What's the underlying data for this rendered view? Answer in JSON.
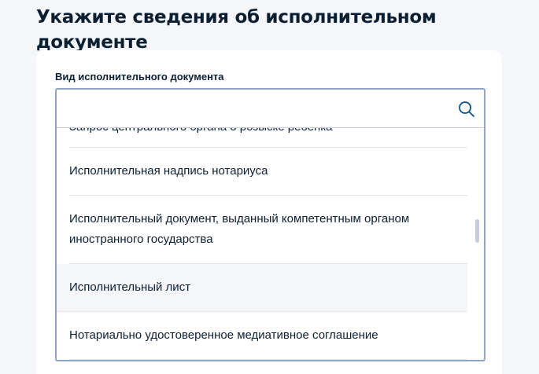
{
  "page": {
    "title": "Укажите сведения об исполнительном документе"
  },
  "form": {
    "field_label": "Вид исполнительного документа",
    "search": {
      "value": "",
      "placeholder": "",
      "icon": "search-icon"
    },
    "options": [
      "Запрос центрального органа о розыске ребенка",
      "Исполнительная надпись нотариуса",
      "Исполнительный документ, выданный компетентным органом иностранного государства",
      "Исполнительный лист",
      "Нотариально удостоверенное медиативное соглашение"
    ],
    "hovered_option": "Исполнительный лист"
  },
  "colors": {
    "accent_border": "#8fa4c6",
    "text": "#0b1f33",
    "hover_bg": "#f4f6f9",
    "page_bg": "#f4f6f9"
  }
}
